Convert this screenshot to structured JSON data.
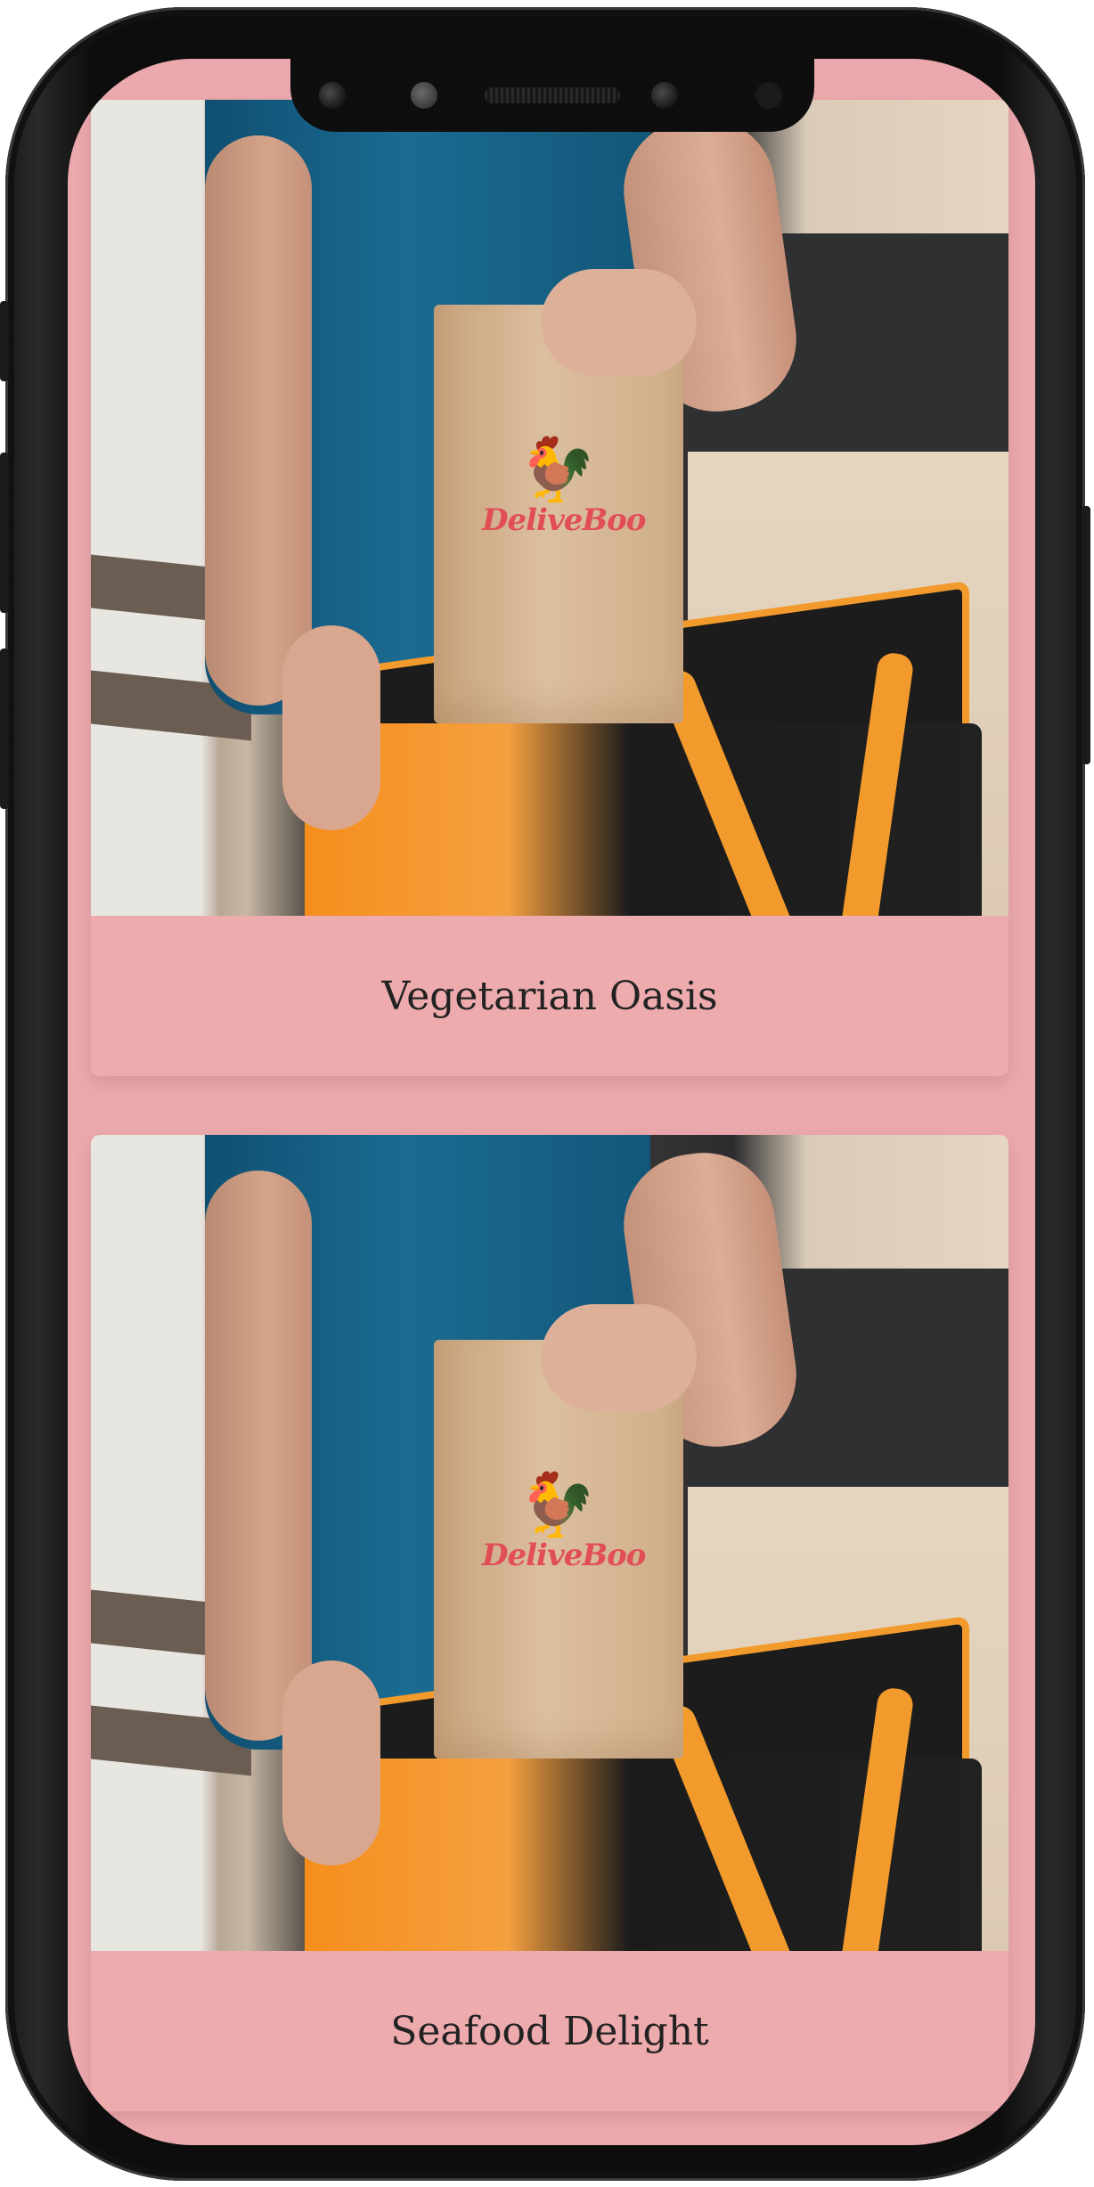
{
  "colors": {
    "screen_background": "#eba9ad",
    "card_background": "#eeabae",
    "title_text": "#222222",
    "logo_red": "#e14e55"
  },
  "cards": [
    {
      "title": "Vegetarian Oasis",
      "image_icon": "delivery-photo-icon",
      "logo_text": "DeliveBoo"
    },
    {
      "title": "Seafood Delight",
      "image_icon": "delivery-photo-icon",
      "logo_text": "DeliveBoo"
    }
  ]
}
